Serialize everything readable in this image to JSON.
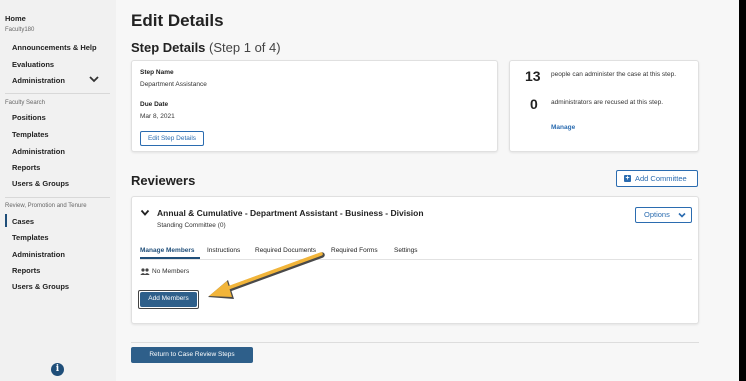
{
  "sidebar": {
    "home": "Home",
    "faculty180_heading": "Faculty180",
    "faculty180_items": [
      "Announcements & Help",
      "Evaluations",
      "Administration"
    ],
    "faculty_search_heading": "Faculty Search",
    "faculty_search_items": [
      "Positions",
      "Templates",
      "Administration",
      "Reports",
      "Users & Groups"
    ],
    "rpt_heading": "Review, Promotion and Tenure",
    "rpt_items": [
      "Cases",
      "Templates",
      "Administration",
      "Reports",
      "Users & Groups"
    ],
    "active_item": "Cases",
    "info_glyph": "i"
  },
  "page": {
    "title": "Edit Details",
    "step_title": "Step Details",
    "step_subtitle": "(Step 1 of 4)"
  },
  "step_card": {
    "step_name_label": "Step Name",
    "step_name_value": "Department Assistance",
    "due_date_label": "Due Date",
    "due_date_value": "Mar 8, 2021",
    "edit_button": "Edit Step Details"
  },
  "stats_card": {
    "admins_count": "13",
    "admins_text": "people can administer the case at this step.",
    "recused_count": "0",
    "recused_text": "administrators are recused at this step.",
    "manage_link": "Manage"
  },
  "reviewers": {
    "heading": "Reviewers",
    "add_committee_button": "Add Committee",
    "committee": {
      "name": "Annual & Cumulative - Department Assistant - Business - Division",
      "subtitle": "Standing Committee (0)",
      "options_button": "Options",
      "tabs": [
        "Manage Members",
        "Instructions",
        "Required Documents",
        "Required Forms",
        "Settings"
      ],
      "active_tab": "Manage Members",
      "members_status": "No Members",
      "add_members_button": "Add Members"
    }
  },
  "footer": {
    "return_button": "Return to Case Review Steps"
  },
  "colors": {
    "accent": "#2b6cb0",
    "primary_dark": "#1f4e79",
    "arrow": "#f2b53a"
  }
}
